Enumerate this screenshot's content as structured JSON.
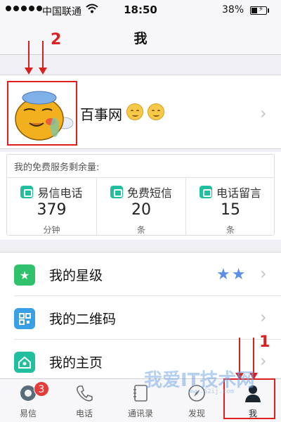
{
  "status_bar": {
    "carrier": "中国联通",
    "time": "18:50",
    "battery": "38%"
  },
  "nav": {
    "title": "我"
  },
  "profile": {
    "name": "百事网"
  },
  "quota": {
    "title": "我的免费服务剩余量:",
    "items": [
      {
        "label": "易信电话",
        "value": "379",
        "unit": "分钟",
        "icon": "phone-icon"
      },
      {
        "label": "免费短信",
        "value": "20",
        "unit": "条",
        "icon": "sms-icon"
      },
      {
        "label": "电话留言",
        "value": "15",
        "unit": "条",
        "icon": "voicemail-icon"
      }
    ]
  },
  "menu": {
    "items": [
      {
        "label": "我的星级",
        "icon": "star-level-icon",
        "color": "#2fc16b"
      },
      {
        "label": "我的二维码",
        "icon": "qrcode-icon",
        "color": "#3aa0e6"
      },
      {
        "label": "我的主页",
        "icon": "homepage-icon",
        "color": "#1fbf9f"
      }
    ],
    "star_rating": 2
  },
  "tab_bar": {
    "items": [
      {
        "label": "易信",
        "icon": "chat-icon",
        "badge": "3"
      },
      {
        "label": "电话",
        "icon": "phone-icon"
      },
      {
        "label": "通讯录",
        "icon": "contacts-icon"
      },
      {
        "label": "发现",
        "icon": "compass-icon"
      },
      {
        "label": "我",
        "icon": "person-icon"
      }
    ]
  },
  "annotations": {
    "one": "1",
    "two": "2"
  },
  "watermark": {
    "main": "我爱IT技术网",
    "sub": "www.52ij.com"
  },
  "colors": {
    "accent": "#1fbf9f",
    "annotation": "#e02020",
    "badge": "#e53b3b"
  }
}
